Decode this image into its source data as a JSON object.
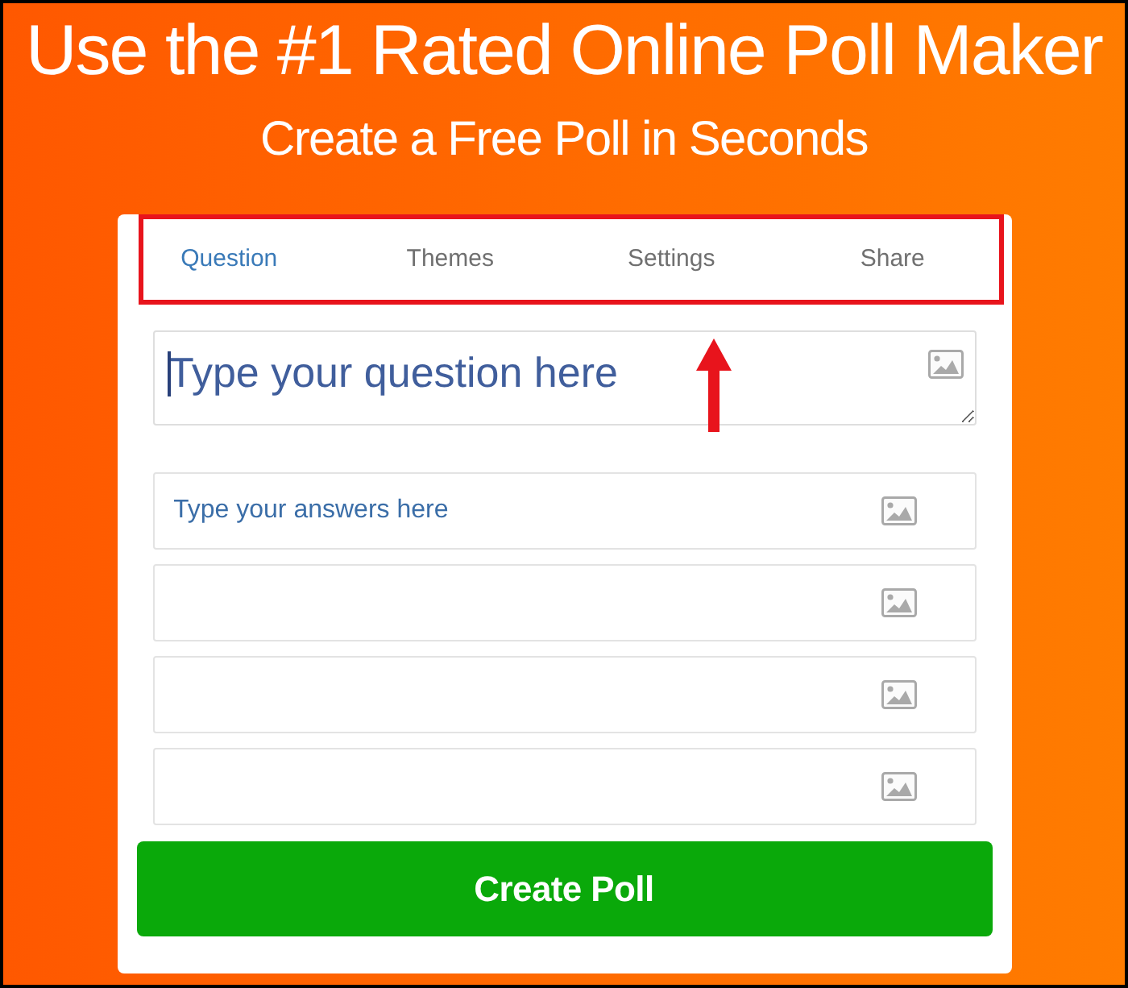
{
  "header": {
    "title": "Use the #1 Rated Online Poll Maker",
    "subtitle": "Create a Free Poll in Seconds"
  },
  "tabs": [
    {
      "label": "Question",
      "selected": true
    },
    {
      "label": "Themes",
      "selected": false
    },
    {
      "label": "Settings",
      "selected": false
    },
    {
      "label": "Share",
      "selected": false
    }
  ],
  "question": {
    "placeholder": "Type your question here",
    "focused": true,
    "image_button": true
  },
  "answers": [
    {
      "placeholder": "Type your answers here",
      "image_button": true
    },
    {
      "image_button": true
    },
    {
      "image_button": true
    },
    {
      "image_button": true
    }
  ],
  "submit": {
    "label": "Create Poll"
  },
  "annotations": {
    "tabs_frame": true,
    "arrow": true
  }
}
